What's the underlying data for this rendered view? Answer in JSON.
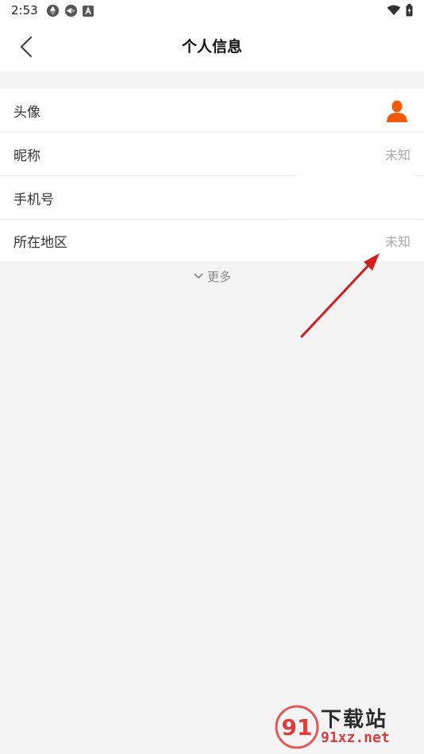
{
  "status_bar": {
    "time": "2:53",
    "icons_left": [
      "aperture-icon",
      "aperture-icon",
      "a-badge-icon"
    ],
    "icons_right": [
      "wifi-icon",
      "battery-icon"
    ]
  },
  "header": {
    "title": "个人信息",
    "back_icon": "chevron-left-icon"
  },
  "profile_rows": [
    {
      "label": "头像",
      "value": null,
      "icon": "avatar-icon"
    },
    {
      "label": "昵称",
      "value": "未知"
    },
    {
      "label": "手机号",
      "value": ""
    },
    {
      "label": "所在地区",
      "value": "未知"
    }
  ],
  "more": {
    "label": "更多",
    "icon": "chevron-down-icon"
  },
  "colors": {
    "avatar": "#f05a0a",
    "annotation_arrow": "#d21e1e",
    "watermark_red": "#e23b3b"
  },
  "watermark": {
    "title": "下载站",
    "url": "91xz.net",
    "logo_text": "91"
  }
}
